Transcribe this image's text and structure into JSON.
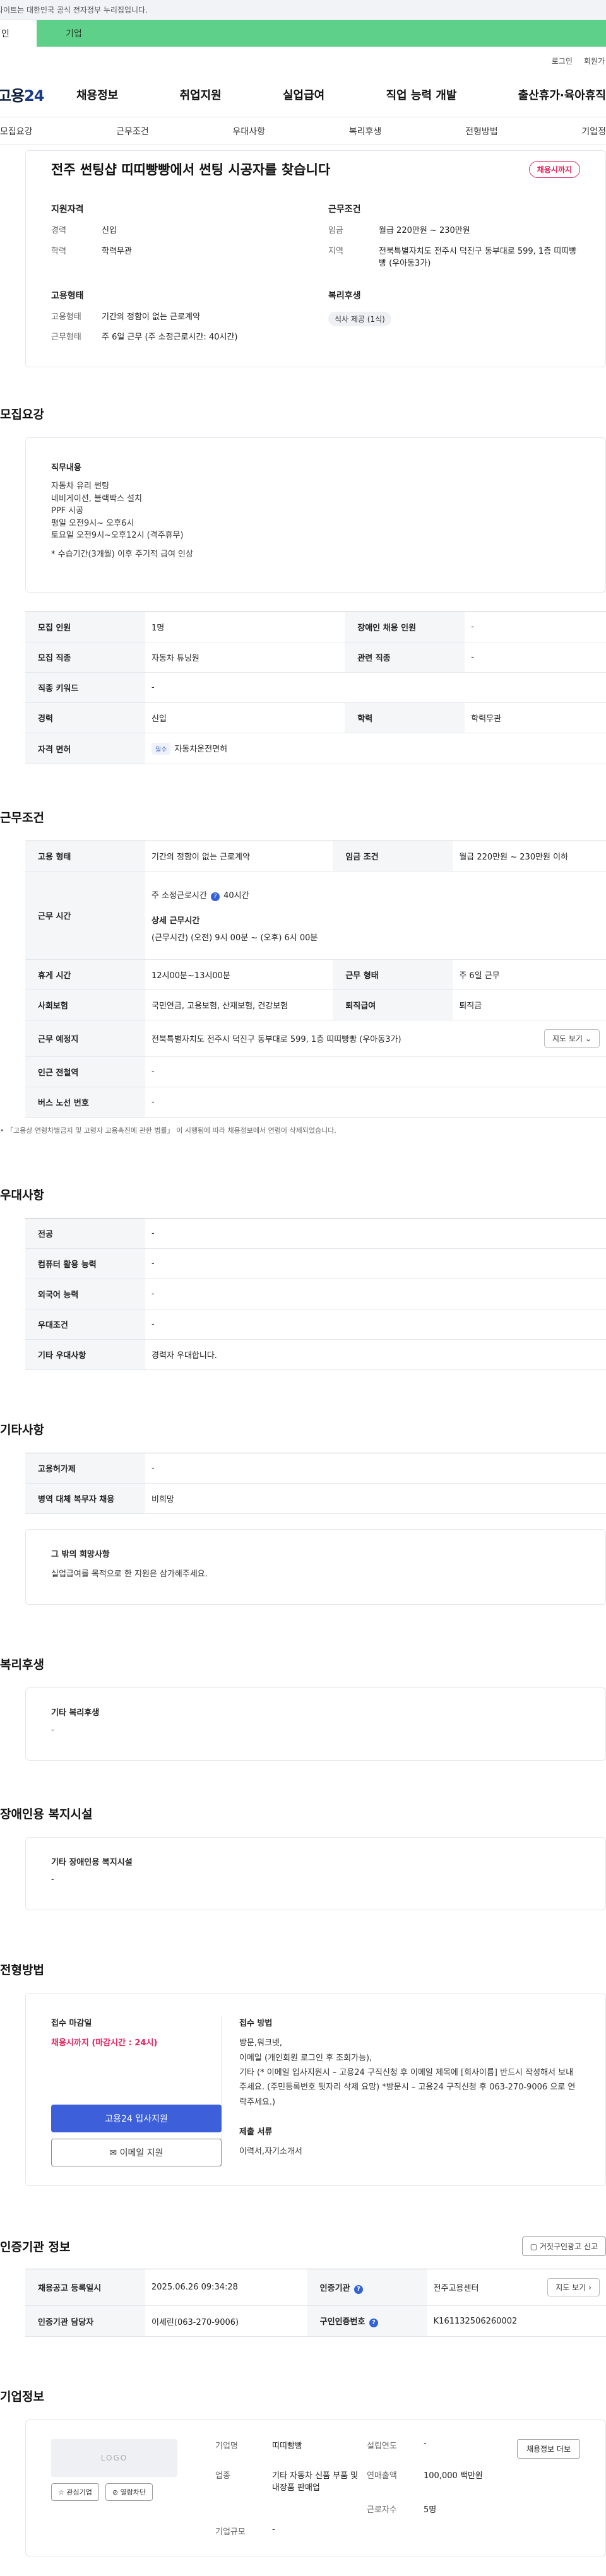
{
  "gov_bar": {
    "text": "사이트는 대한민국 공식 전자정부 누리집입니다."
  },
  "user_tabs": {
    "personal": "인",
    "company": "기업"
  },
  "top_links": {
    "login": "로그인",
    "signup": "회원가"
  },
  "logo": {
    "text_a": "고용",
    "text_b": "24"
  },
  "main_nav": [
    "채용정보",
    "취업지원",
    "실업급여",
    "직업 능력 개발",
    "출산휴가·육아휴직"
  ],
  "sub_nav": [
    "모집요강",
    "근무조건",
    "우대사항",
    "복리후생",
    "전형방법",
    "기업정"
  ],
  "summary": {
    "title": "전주 썬팅샵 띠띠빵빵에서 썬팅 시공자를 찾습니다",
    "badge": "채용시까지",
    "qualification": {
      "heading": "지원자격",
      "career_k": "경력",
      "career_v": "신입",
      "edu_k": "학력",
      "edu_v": "학력무관"
    },
    "conditions": {
      "heading": "근무조건",
      "wage_k": "임금",
      "wage_v": "월급 220만원 ~ 230만원",
      "area_k": "지역",
      "area_v": "전북특별자치도 전주시 덕진구 동부대로 599, 1층 띠띠빵빵 (우아동3가)"
    },
    "employment": {
      "heading": "고용형태",
      "type_k": "고용형태",
      "type_v": "기간의 정함이 없는 근로계약",
      "work_k": "근무형태",
      "work_v": "주 6일 근무 (주 소정근로시간: 40시간)"
    },
    "welfare": {
      "heading": "복리후생",
      "chip": "식사 제공 (1식)"
    }
  },
  "recruit": {
    "title": "모집요강",
    "duty_heading": "직무내용",
    "duty_lines": [
      "자동차 유리 썬팅",
      "네비게이션, 블랙박스 설치",
      "PPF 시공",
      "평일 오전9시~ 오후6시",
      "토요일 오전9시~오후12시 (격주휴무)",
      "",
      "* 수습기간(3개월) 이후 주기적 급여 인상"
    ],
    "rows": [
      {
        "k1": "모집 인원",
        "v1": "1명",
        "k2": "장애인 채용 인원",
        "v2": "-"
      },
      {
        "k1": "모집 직종",
        "v1": "자동차 튜닝원",
        "k2": "관련 직종",
        "v2": "-"
      },
      {
        "k1": "직종 키워드",
        "v1": "-",
        "k2": "",
        "v2": ""
      },
      {
        "k1": "경력",
        "v1": "신입",
        "k2": "학력",
        "v2": "학력무관"
      }
    ],
    "license_k": "자격 면허",
    "license_tag": "필수",
    "license_v": "자동차운전면허"
  },
  "work": {
    "title": "근무조건",
    "type_k": "고용 형태",
    "type_v": "기간의 정함이 없는 근로계약",
    "wage_k": "임금 조건",
    "wage_v": "월급 220만원 ~ 230만원 이하",
    "hours_k": "근무 시간",
    "hours_main": "주 소정근로시간",
    "hours_main_v": "40시간",
    "hours_detail_h": "상세 근무시간",
    "hours_detail_v": "(근무시간) (오전) 9시 00분 ~ (오후) 6시 00분",
    "break_k": "휴게 시간",
    "break_v": "12시00분~13시00분",
    "shape_k": "근무 형태",
    "shape_v": "주 6일 근무",
    "insurance_k": "사회보험",
    "insurance_v": "국민연금, 고용보험, 산재보험, 건강보험",
    "retire_k": "퇴직급여",
    "retire_v": "퇴직금",
    "place_k": "근무 예정지",
    "place_v": "전북특별자치도 전주시 덕진구 동부대로 599, 1층 띠띠빵빵 (우아동3가)",
    "map_btn": "지도 보기",
    "subway_k": "인근 전철역",
    "subway_v": "-",
    "bus_k": "버스 노선 번호",
    "bus_v": "-",
    "note": "「고용상 연령차별금지 및 고령자 고용촉진에 관한 법률」 이 시행됨에 따라 채용정보에서 연령이 삭제되었습니다."
  },
  "preference": {
    "title": "우대사항",
    "rows": [
      {
        "k": "전공",
        "v": "-"
      },
      {
        "k": "컴퓨터 활용 능력",
        "v": "-"
      },
      {
        "k": "외국어 능력",
        "v": "-"
      },
      {
        "k": "우대조건",
        "v": "-"
      },
      {
        "k": "기타 우대사항",
        "v": "경력자 우대합니다."
      }
    ]
  },
  "etc": {
    "title": "기타사항",
    "rows": [
      {
        "k": "고용허가제",
        "v": "-"
      },
      {
        "k": "병역 대체 복무자 채용",
        "v": "비희망"
      }
    ],
    "wish_h": "그 밖의 희망사항",
    "wish_v": "실업급여를 목적으로 한 지원은 삼가해주세요."
  },
  "welfare_sec": {
    "title": "복리후생",
    "h": "기타 복리후생",
    "v": "-"
  },
  "disability": {
    "title": "장애인용 복지시설",
    "h": "기타 장애인용 복지시설",
    "v": "-"
  },
  "process": {
    "title": "전형방법",
    "deadline_h": "접수 마감일",
    "deadline_v": "채용시까지 (마감시간 : 24시)",
    "apply_btn": "고용24 입사지원",
    "email_btn": "이메일 지원",
    "method_h": "접수 방법",
    "method_v": "방문,워크넷,\n이메일 (개인회원 로그인 후 조회가능),\n기타 (* 이메일 입사지원시 – 고용24 구직신청 후 이메일 제목에 [회사이름] 반드시 작성해서 보내주세요. (주민등록번호 뒷자리 삭제 요망) *방문시 – 고용24 구직신청 후 063-270-9006 으로 연락주세요.)",
    "docs_h": "제출 서류",
    "docs_v": "이력서,자기소개서"
  },
  "agency": {
    "title": "인증기관 정보",
    "report_btn": "거짓구인광고 신고",
    "reg_k": "채용공고 등록일시",
    "reg_v": "2025.06.26 09:34:28",
    "org_k": "인증기관",
    "org_v": "전주고용센터",
    "map_btn": "지도 보기",
    "mgr_k": "인증기관 담당자",
    "mgr_v": "이세린(063-270-9006)",
    "no_k": "구인인증번호",
    "no_v": "K161132506260002"
  },
  "company": {
    "title": "기업정보",
    "logo_ph": "LOGO",
    "fav_btn": "관심기업",
    "block_btn": "열람차단",
    "name_k": "기업명",
    "name_v": "띠띠빵빵",
    "year_k": "설립연도",
    "year_v": "-",
    "industry_k": "업종",
    "industry_v": "기타 자동차 신품 부품 및 내장품 판매업",
    "sales_k": "연매출액",
    "sales_v": "100,000 백만원",
    "emp_k": "근로자수",
    "emp_v": "5명",
    "scale_k": "기업규모",
    "scale_v": "-",
    "info_btn": "채용정보 더보"
  }
}
